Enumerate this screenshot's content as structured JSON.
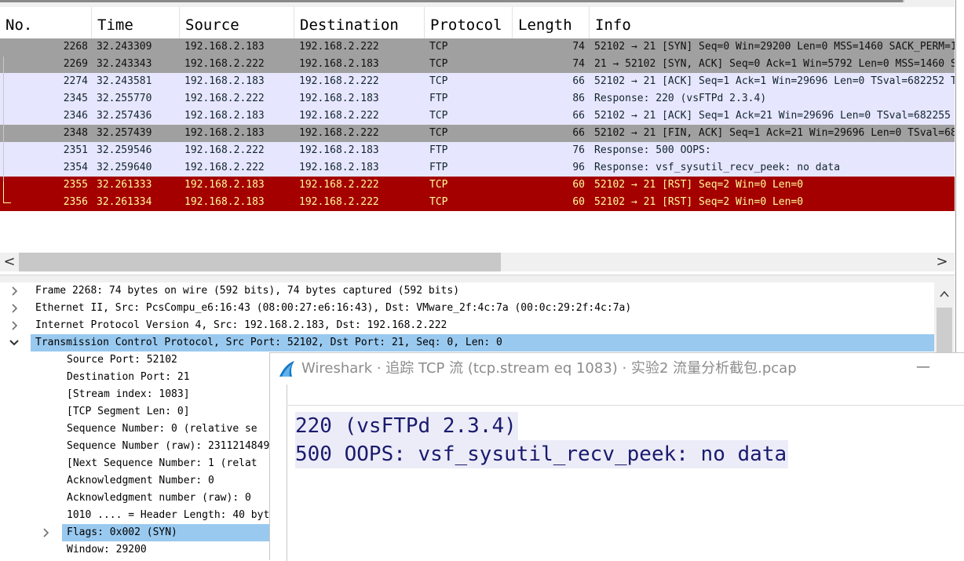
{
  "packet_list": {
    "columns": [
      "No.",
      "Time",
      "Source",
      "Destination",
      "Protocol",
      "Length",
      "Info"
    ],
    "rows": [
      {
        "no": "2268",
        "time": "32.243309",
        "src": "192.168.2.183",
        "dst": "192.168.2.222",
        "proto": "TCP",
        "len": "74",
        "info": "52102 → 21 [SYN] Seq=0 Win=29200 Len=0 MSS=1460 SACK_PERM=1",
        "style": "tcp-gray"
      },
      {
        "no": "2269",
        "time": "32.243343",
        "src": "192.168.2.222",
        "dst": "192.168.2.183",
        "proto": "TCP",
        "len": "74",
        "info": "21 → 52102 [SYN, ACK] Seq=0 Ack=1 Win=5792 Len=0 MSS=1460 SA",
        "style": "tcp-gray"
      },
      {
        "no": "2274",
        "time": "32.243581",
        "src": "192.168.2.183",
        "dst": "192.168.2.222",
        "proto": "TCP",
        "len": "66",
        "info": "52102 → 21 [ACK] Seq=1 Ack=1 Win=29696 Len=0 TSval=682252 TS",
        "style": "light"
      },
      {
        "no": "2345",
        "time": "32.255770",
        "src": "192.168.2.222",
        "dst": "192.168.2.183",
        "proto": "FTP",
        "len": "86",
        "info": "Response: 220 (vsFTPd 2.3.4)",
        "style": "light"
      },
      {
        "no": "2346",
        "time": "32.257436",
        "src": "192.168.2.183",
        "dst": "192.168.2.222",
        "proto": "TCP",
        "len": "66",
        "info": "52102 → 21 [ACK] Seq=1 Ack=21 Win=29696 Len=0 TSval=682255 T",
        "style": "light"
      },
      {
        "no": "2348",
        "time": "32.257439",
        "src": "192.168.2.183",
        "dst": "192.168.2.222",
        "proto": "TCP",
        "len": "66",
        "info": "52102 → 21 [FIN, ACK] Seq=1 Ack=21 Win=29696 Len=0 TSval=682",
        "style": "tcp-gray"
      },
      {
        "no": "2351",
        "time": "32.259546",
        "src": "192.168.2.222",
        "dst": "192.168.2.183",
        "proto": "FTP",
        "len": "76",
        "info": "Response: 500 OOPS:",
        "style": "light"
      },
      {
        "no": "2354",
        "time": "32.259640",
        "src": "192.168.2.222",
        "dst": "192.168.2.183",
        "proto": "FTP",
        "len": "96",
        "info": "Response: vsf_sysutil_recv_peek: no data",
        "style": "light"
      },
      {
        "no": "2355",
        "time": "32.261333",
        "src": "192.168.2.183",
        "dst": "192.168.2.222",
        "proto": "TCP",
        "len": "60",
        "info": "52102 → 21 [RST] Seq=2 Win=0 Len=0",
        "style": "red"
      },
      {
        "no": "2356",
        "time": "32.261334",
        "src": "192.168.2.183",
        "dst": "192.168.2.222",
        "proto": "TCP",
        "len": "60",
        "info": "52102 → 21 [RST] Seq=2 Win=0 Len=0",
        "style": "red"
      }
    ],
    "scroll_left_glyph": "<",
    "scroll_right_glyph": ">"
  },
  "detail_tree": {
    "items": [
      {
        "text": "Frame 2268: 74 bytes on wire (592 bits), 74 bytes captured (592 bits)",
        "expander": ">",
        "depth": 0,
        "selected": false
      },
      {
        "text": "Ethernet II, Src: PcsCompu_e6:16:43 (08:00:27:e6:16:43), Dst: VMware_2f:4c:7a (00:0c:29:2f:4c:7a)",
        "expander": ">",
        "depth": 0,
        "selected": false
      },
      {
        "text": "Internet Protocol Version 4, Src: 192.168.2.183, Dst: 192.168.2.222",
        "expander": ">",
        "depth": 0,
        "selected": false
      },
      {
        "text": "Transmission Control Protocol, Src Port: 52102, Dst Port: 21, Seq: 0, Len: 0",
        "expander": "v",
        "depth": 0,
        "selected": true
      },
      {
        "text": "Source Port: 52102",
        "expander": "",
        "depth": 1,
        "selected": false
      },
      {
        "text": "Destination Port: 21",
        "expander": "",
        "depth": 1,
        "selected": false
      },
      {
        "text": "[Stream index: 1083]",
        "expander": "",
        "depth": 1,
        "selected": false
      },
      {
        "text": "[TCP Segment Len: 0]",
        "expander": "",
        "depth": 1,
        "selected": false
      },
      {
        "text": "Sequence Number: 0    (relative se",
        "expander": "",
        "depth": 1,
        "selected": false
      },
      {
        "text": "Sequence Number (raw): 2311214849",
        "expander": "",
        "depth": 1,
        "selected": false
      },
      {
        "text": "[Next Sequence Number: 1    (relat",
        "expander": "",
        "depth": 1,
        "selected": false
      },
      {
        "text": "Acknowledgment Number: 0",
        "expander": "",
        "depth": 1,
        "selected": false
      },
      {
        "text": "Acknowledgment number (raw): 0",
        "expander": "",
        "depth": 1,
        "selected": false
      },
      {
        "text": "1010 .... = Header Length: 40 byte",
        "expander": "",
        "depth": 1,
        "selected": false
      },
      {
        "text": "Flags: 0x002 (SYN)",
        "expander": ">",
        "depth": 1,
        "selected": true
      },
      {
        "text": "Window: 29200",
        "expander": "",
        "depth": 1,
        "selected": false
      }
    ],
    "scroll_up_glyph": "^"
  },
  "stream_window": {
    "title": "Wireshark · 追踪 TCP 流 (tcp.stream eq 1083) · 实验2 流量分析截包.pcap",
    "minimize_glyph": "—",
    "lines": [
      "220 (vsFTPd 2.3.4)",
      "500 OOPS: vsf_sysutil_recv_peek: no data"
    ]
  },
  "colors": {
    "tcp_gray": "#a0a0a0",
    "light_row": "#e7e6ff",
    "rst_red": "#a40000",
    "rst_text": "#fffc9c",
    "selection": "#99c9ef",
    "stream_text": "#1a1a6e"
  }
}
